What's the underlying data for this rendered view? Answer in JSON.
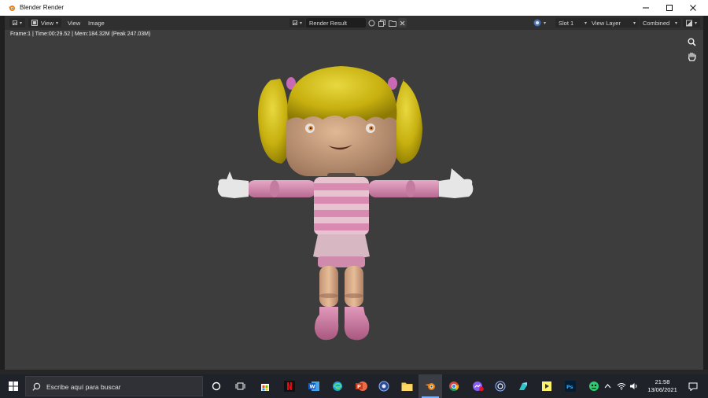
{
  "window": {
    "title": "Blender Render"
  },
  "header": {
    "view_menu": "View",
    "view_menu2": "View",
    "image_menu": "Image",
    "image_name": "Render Result",
    "slot": "Slot 1",
    "view_layer": "View Layer",
    "pass": "Combined"
  },
  "viewport": {
    "stats": "Frame:1 | Time:00:29.52 | Mem:184.32M (Peak 247.03M)"
  },
  "taskbar": {
    "search_placeholder": "Escribe aquí para buscar",
    "time": "21:58",
    "date": "13/06/2021"
  },
  "colors": {
    "accent": "#e87d0d",
    "viewport_bg": "#3d3d3d",
    "hair": "#c8b410",
    "stripe_pink": "#d98ab0"
  }
}
